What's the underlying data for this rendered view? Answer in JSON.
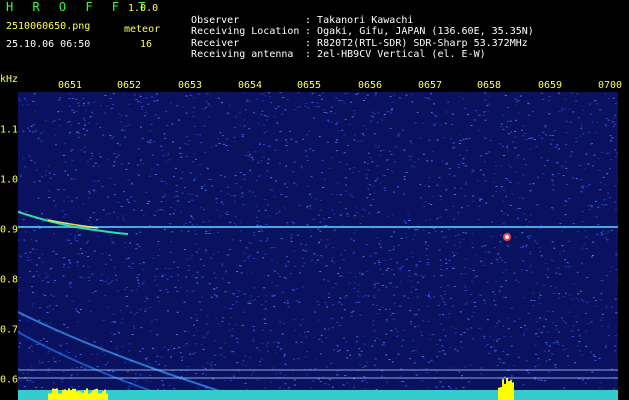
{
  "header": {
    "app_title": "H R O F F T",
    "version": "1.0.0",
    "file_name": "2510060650.png",
    "timestamp": "25.10.06 06:50",
    "meteor_label": "meteor",
    "meteor_count": "16"
  },
  "info": [
    {
      "key": "Observer",
      "value": "Takanori Kawachi"
    },
    {
      "key": "Receiving Location",
      "value": "Ogaki, Gifu, JAPAN (136.60E, 35.35N)"
    },
    {
      "key": "Receiver",
      "value": "R820T2(RTL-SDR) SDR-Sharp 53.372MHz"
    },
    {
      "key": "Receiving antenna",
      "value": "2el-HB9CV Vertical (el. E-W)"
    }
  ],
  "axes": {
    "y_unit": "kHz",
    "x_ticks": [
      "0651",
      "0652",
      "0653",
      "0654",
      "0655",
      "0656",
      "0657",
      "0658",
      "0659",
      "0700"
    ],
    "y_ticks": [
      "1.1",
      "1.0",
      "0.9",
      "0.8",
      "0.7",
      "0.6"
    ]
  },
  "colors": {
    "background": "#000000",
    "noise": "#1a2aa0",
    "carrier": "#55ccff",
    "text_yellow": "#ffff55",
    "text_green": "#33ff33",
    "bottom_band": "#33cccc",
    "peaks": "#ffff00"
  }
}
